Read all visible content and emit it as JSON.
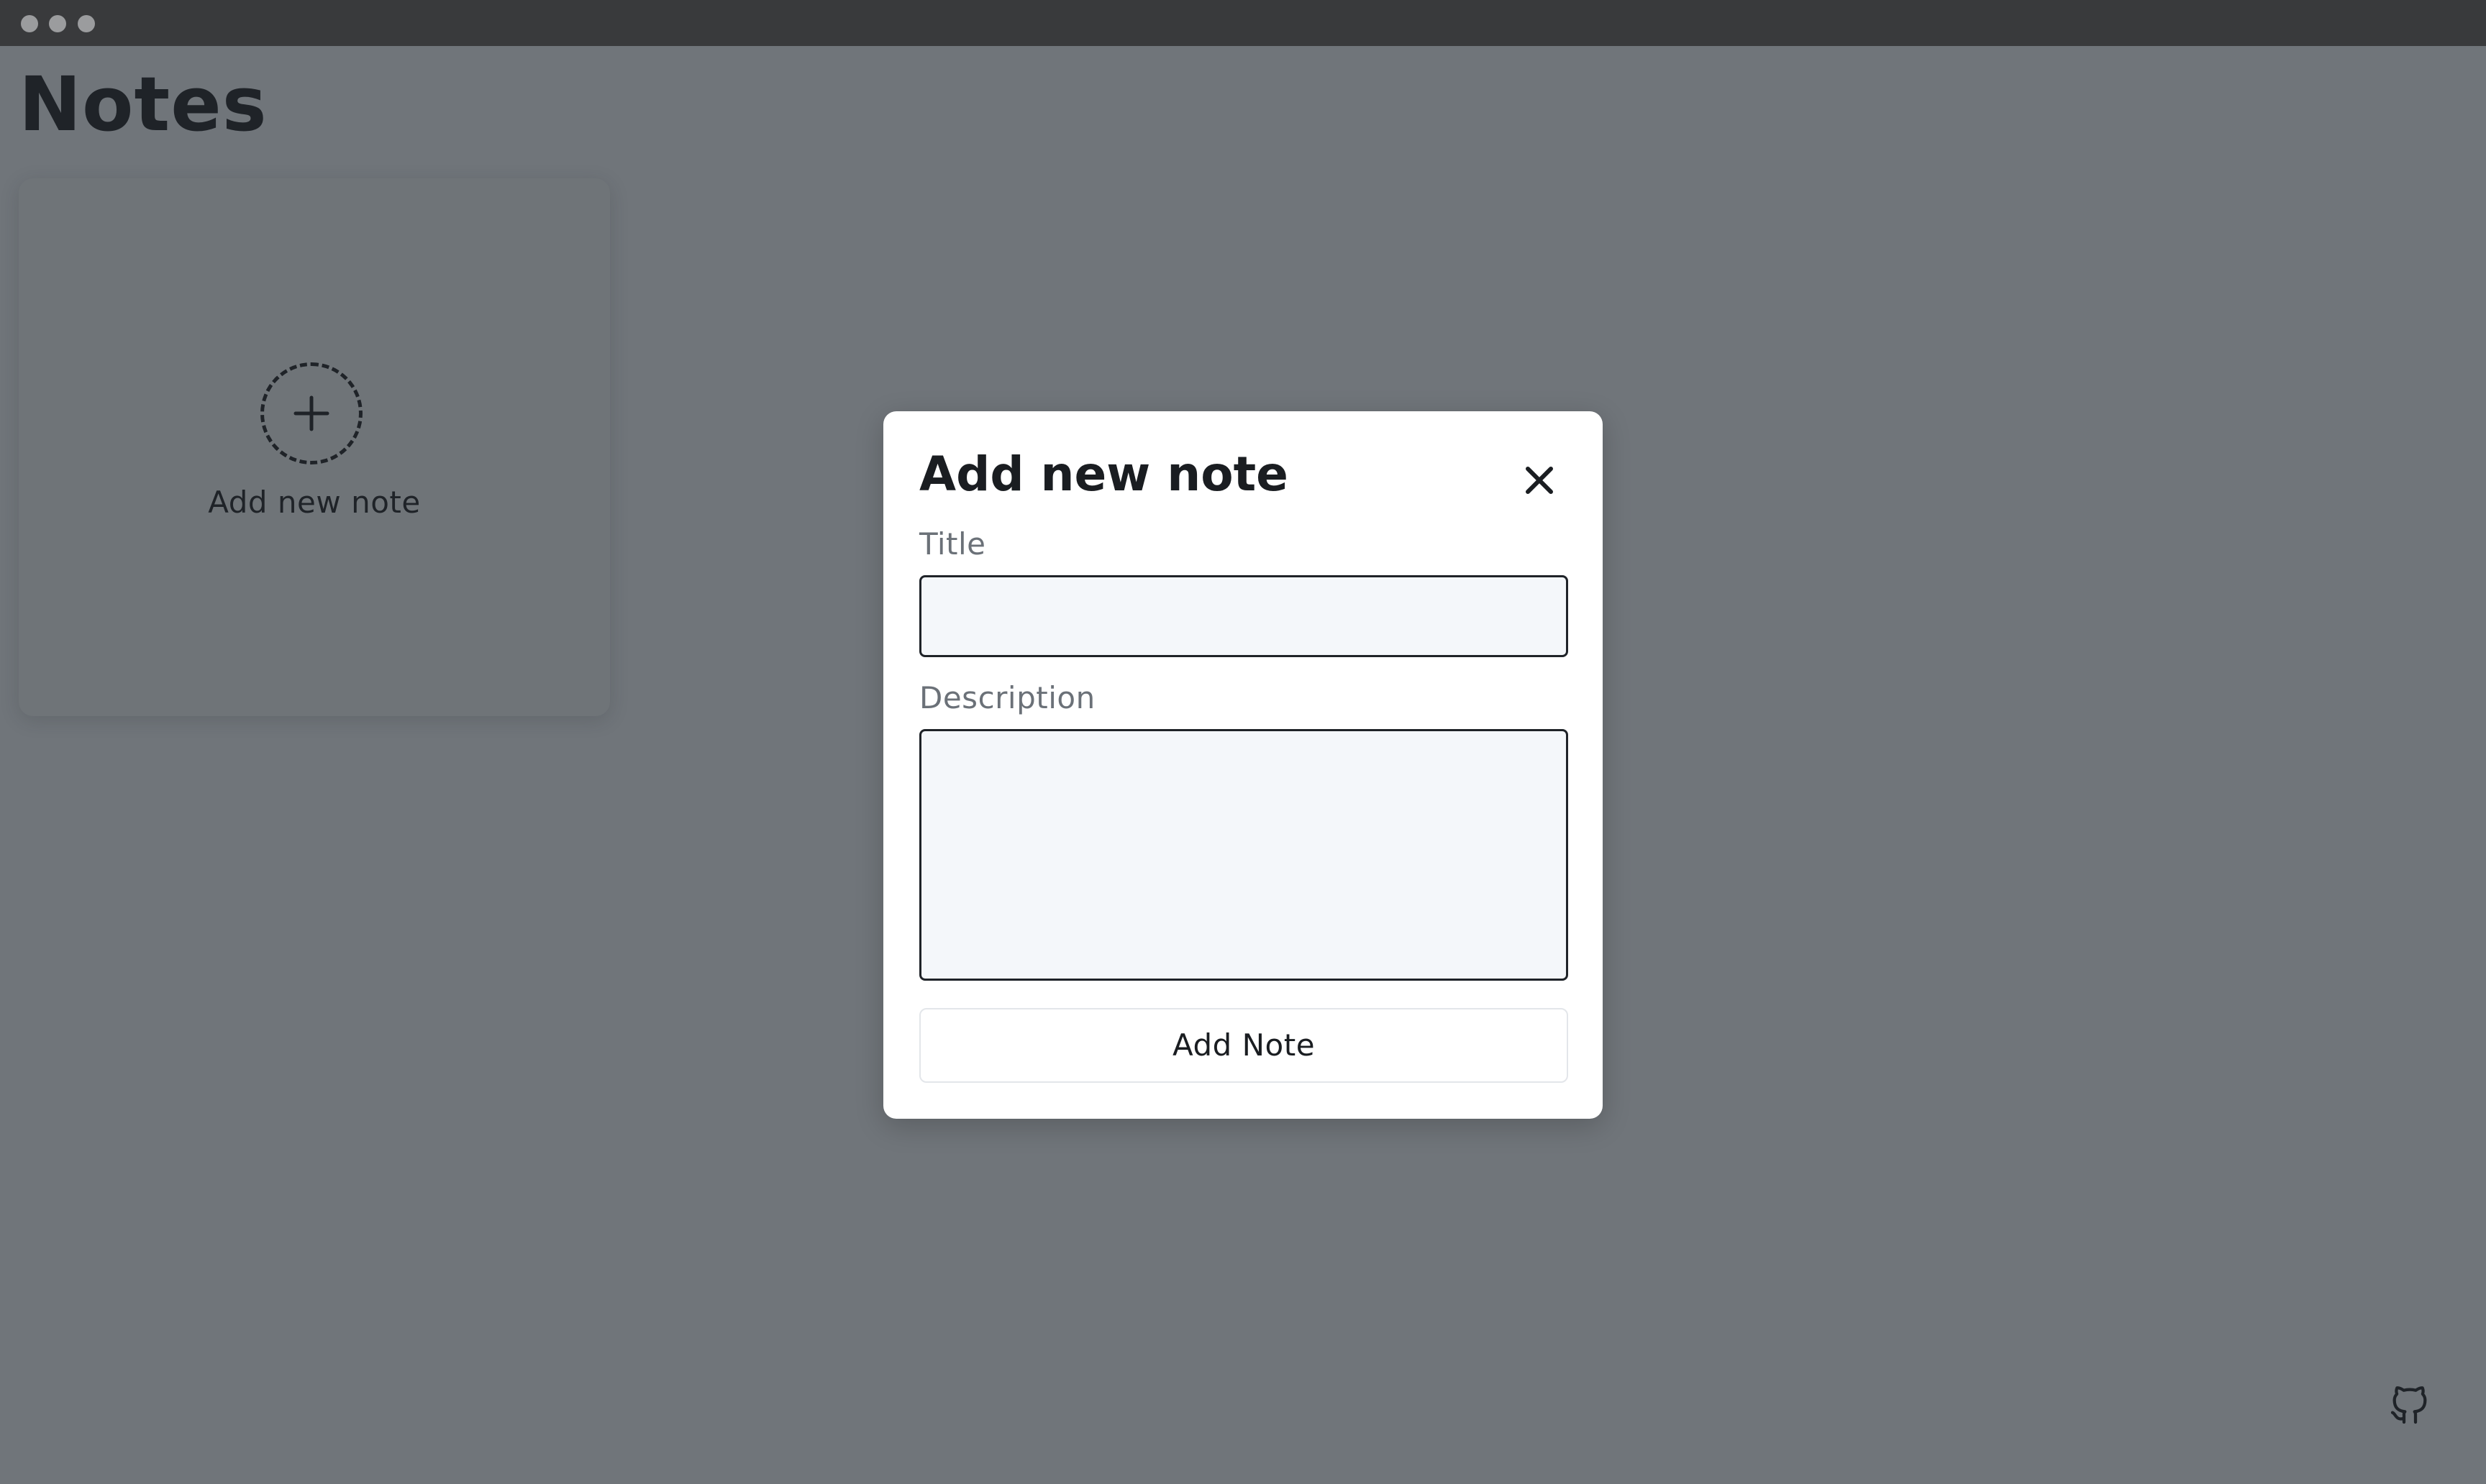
{
  "page": {
    "title": "Notes"
  },
  "add_card": {
    "label": "Add new note",
    "icon": "plus-icon"
  },
  "modal": {
    "title": "Add new note",
    "close_icon": "close-icon",
    "title_field": {
      "label": "Title",
      "value": "",
      "placeholder": ""
    },
    "description_field": {
      "label": "Description",
      "value": "",
      "placeholder": ""
    },
    "submit_label": "Add Note"
  },
  "footer": {
    "github_icon": "github-icon"
  },
  "colors": {
    "overlay": "#70757a",
    "titlebar": "#393a3c",
    "modal_bg": "#ffffff",
    "input_bg": "#f4f7fa",
    "text_dark": "#1f2328",
    "label_gray": "#6b7178"
  }
}
